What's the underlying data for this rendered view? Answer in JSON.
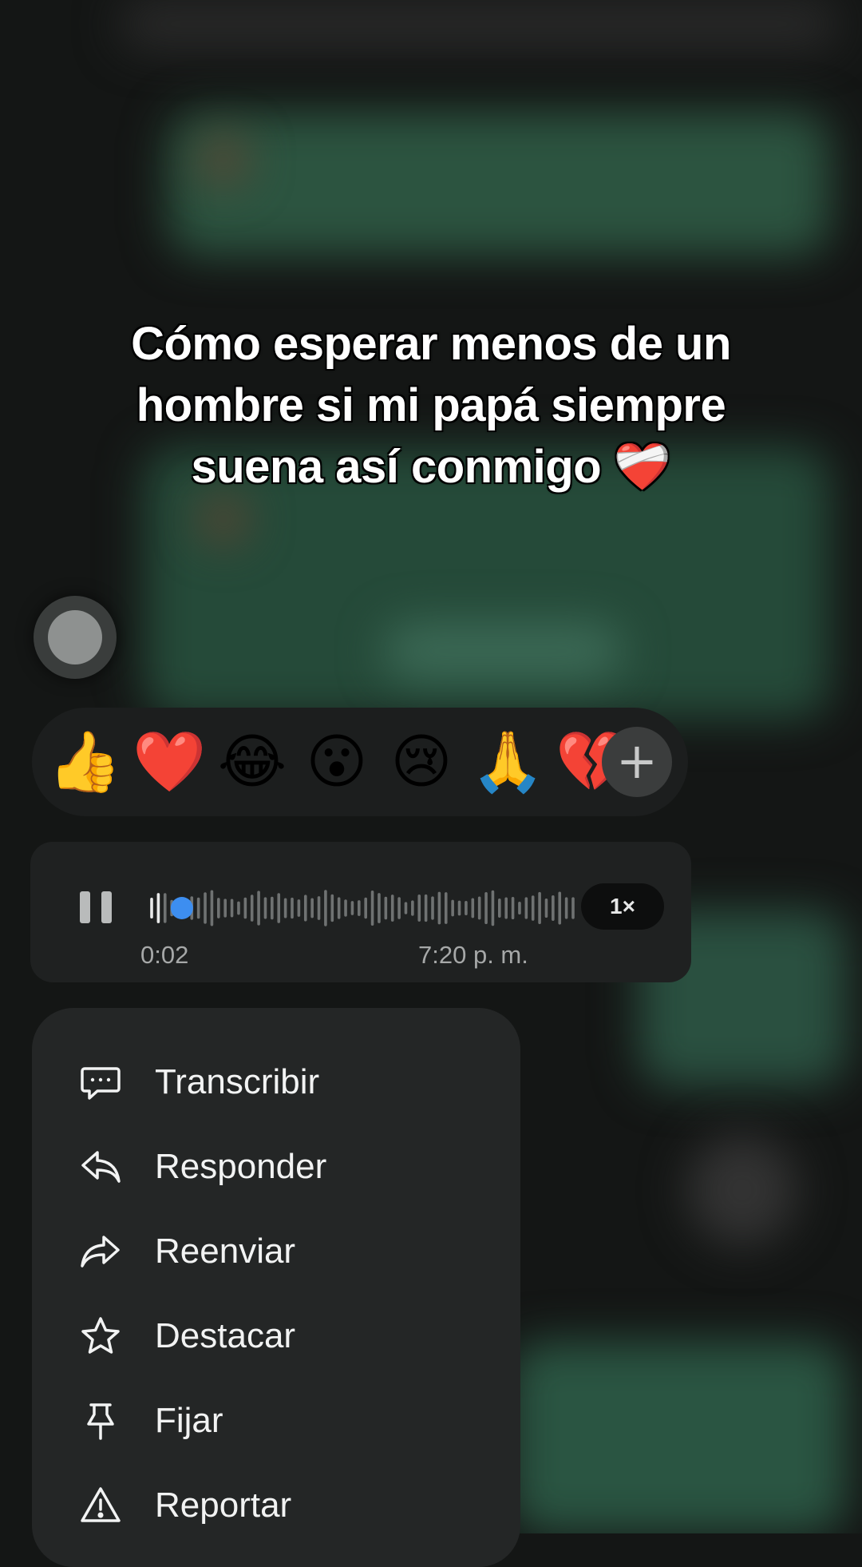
{
  "caption": {
    "line1": "Cómo esperar menos de un",
    "line2": "hombre si mi papá siempre",
    "line3": "suena así conmigo ❤️‍🩹"
  },
  "reactions": {
    "emojis": [
      "👍",
      "❤️",
      "😂",
      "😮",
      "😢",
      "🙏",
      "💔"
    ],
    "more_icon": "plus-icon",
    "more_label": "+"
  },
  "voice_message": {
    "current_time": "0:02",
    "sent_time": "7:20 p. m.",
    "speed": "1×",
    "progress": 0.03,
    "state_icon": "pause-icon"
  },
  "menu": {
    "items": [
      {
        "label": "Transcribir",
        "icon": "transcribe-icon"
      },
      {
        "label": "Responder",
        "icon": "reply-icon"
      },
      {
        "label": "Reenviar",
        "icon": "forward-icon"
      },
      {
        "label": "Destacar",
        "icon": "star-icon"
      },
      {
        "label": "Fijar",
        "icon": "pin-icon"
      },
      {
        "label": "Reportar",
        "icon": "warning-icon"
      }
    ]
  },
  "colors": {
    "background": "#141615",
    "panel": "#1f2121",
    "menu": "#242626",
    "progress_dot": "#3d8ef0",
    "blurred_bubble": "#2c5c45"
  }
}
